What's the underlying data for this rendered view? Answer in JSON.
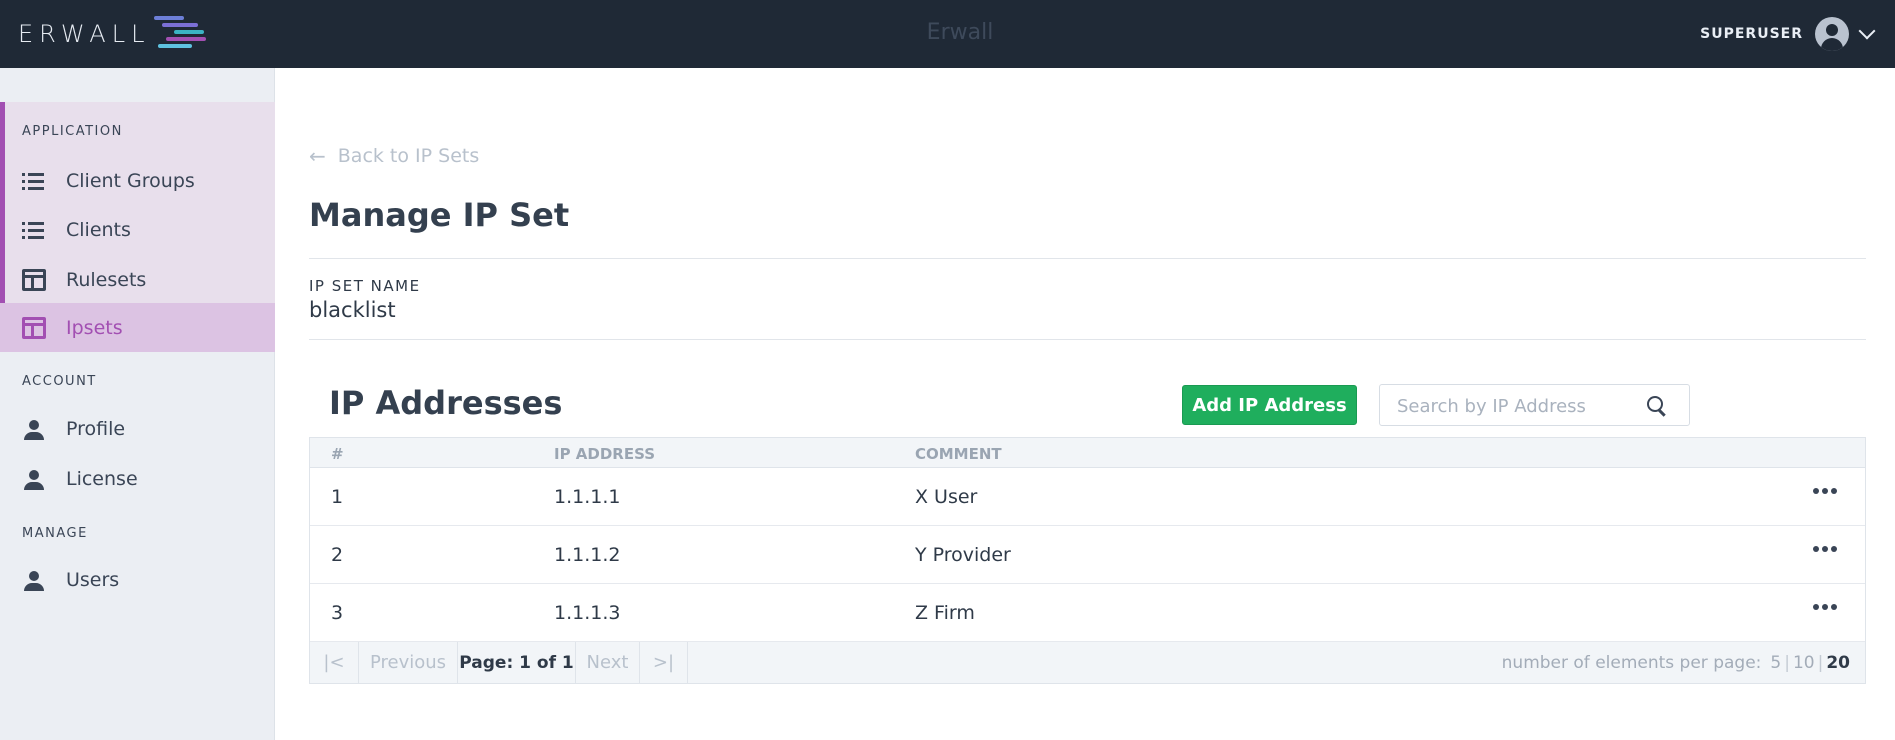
{
  "header": {
    "logo_text": "ERWALL",
    "app_title": "Erwall",
    "user_name": "SUPERUSER",
    "logo_colors": [
      "#7b6fd6",
      "#3bb3c3",
      "#a24fb2",
      "#5ec2e0"
    ]
  },
  "sidebar": {
    "sections": {
      "application": "APPLICATION",
      "account": "ACCOUNT",
      "manage": "MANAGE"
    },
    "items": [
      {
        "label": "Client Groups",
        "icon": "list-icon"
      },
      {
        "label": "Clients",
        "icon": "list-icon"
      },
      {
        "label": "Rulesets",
        "icon": "window-icon"
      },
      {
        "label": "Ipsets",
        "icon": "window-icon",
        "active": true
      },
      {
        "label": "Profile",
        "icon": "person-icon"
      },
      {
        "label": "License",
        "icon": "person-icon"
      },
      {
        "label": "Users",
        "icon": "person-icon"
      }
    ],
    "accent_color": "#a24fb2"
  },
  "main": {
    "back_link": "Back to IP Sets",
    "page_title": "Manage IP Set",
    "field_label": "IP SET NAME",
    "field_value": "blacklist",
    "section_title": "IP Addresses",
    "add_button": "Add IP Address",
    "search_placeholder": "Search by IP Address",
    "table": {
      "columns": [
        "#",
        "IP ADDRESS",
        "COMMENT"
      ],
      "rows": [
        {
          "num": "1",
          "ip": "1.1.1.1",
          "comment": "X User"
        },
        {
          "num": "2",
          "ip": "1.1.1.2",
          "comment": "Y Provider"
        },
        {
          "num": "3",
          "ip": "1.1.1.3",
          "comment": "Z Firm"
        }
      ]
    },
    "pagination": {
      "first": "|<",
      "previous": "Previous",
      "page_info": "Page: 1 of 1",
      "next": "Next",
      "last": ">|",
      "per_page_label": "number of elements per page:",
      "per_page_options": [
        "5",
        "10",
        "20"
      ],
      "per_page_selected": "20"
    },
    "button_color": "#1fae5d"
  }
}
